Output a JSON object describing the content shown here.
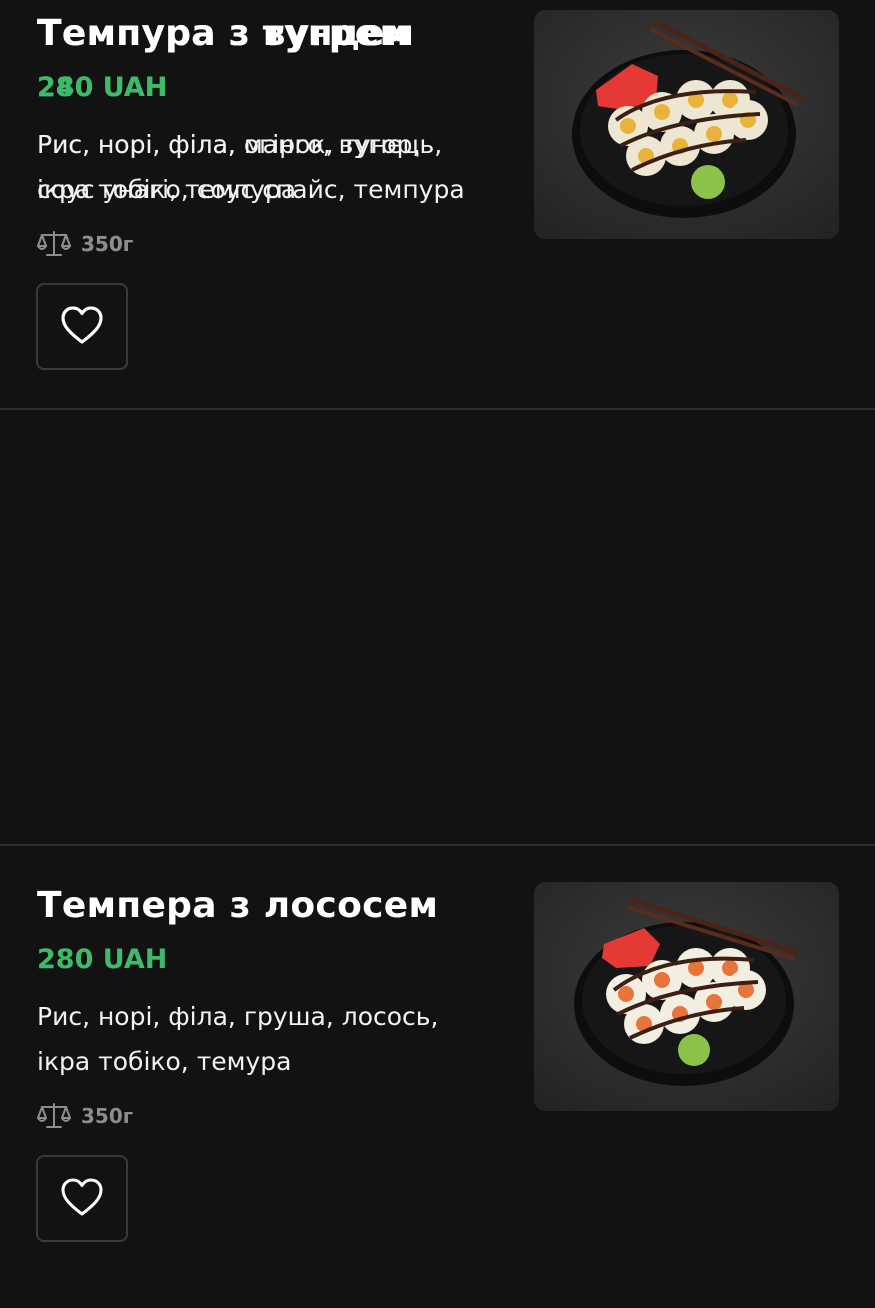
{
  "items": [
    {
      "title": "Темпура з тунцем",
      "price": "240 UAH",
      "description": "Рис, норі, філа, огірок, тунець,\nікра тобіко, соус спайс, темпура",
      "weight": "350г"
    },
    {
      "title": "Темпера з лососем",
      "price": "280 UAH",
      "description": "Рис, норі, філа, груша, лосось,\nікра тобіко, темура",
      "weight": "350г"
    },
    {
      "title": "Темпура з вугрем",
      "price": "280 UAH",
      "description": "Рис, норі, філа,  манго, вугор,\nсоус унагі, темпура",
      "weight": "350г"
    }
  ],
  "colors": {
    "background": "#121212",
    "price": "#3dbb6a",
    "text": "#ffffff",
    "muted": "#8c8c8c",
    "border": "#3a3a3a",
    "divider": "#2e2e2e"
  },
  "icons": {
    "weight": "scales-icon",
    "favorite": "heart-outline-icon"
  }
}
